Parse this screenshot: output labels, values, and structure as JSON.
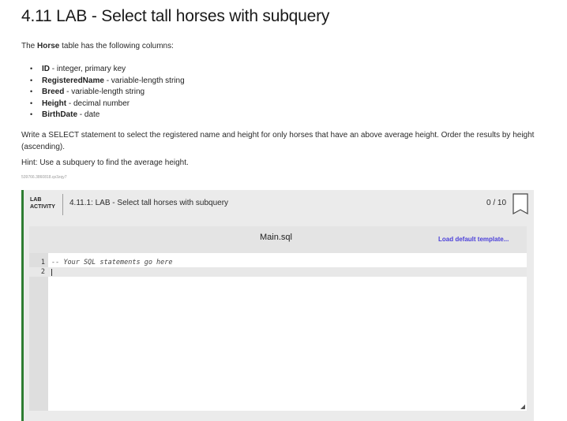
{
  "page": {
    "title": "4.11 LAB - Select tall horses with subquery",
    "intro_pre": "The ",
    "intro_table": "Horse",
    "intro_post": " table has the following columns:",
    "columns": [
      {
        "name": "ID",
        "desc": " - integer, primary key"
      },
      {
        "name": "RegisteredName",
        "desc": " - variable-length string"
      },
      {
        "name": "Breed",
        "desc": " - variable-length string"
      },
      {
        "name": "Height",
        "desc": " - decimal number"
      },
      {
        "name": "BirthDate",
        "desc": " - date"
      }
    ],
    "instructions": "Write a SELECT statement to select the registered name and height for only horses that have an above average height. Order the results by height (ascending).",
    "hint": "Hint: Use a subquery to find the average height.",
    "tracking_code": "539766.3860818.qx3zqy7"
  },
  "activity": {
    "label_line1": "LAB",
    "label_line2": "ACTIVITY",
    "title": "4.11.1: LAB - Select tall horses with subquery",
    "score": "0 / 10",
    "accent_color": "#2e7d32"
  },
  "editor": {
    "filename": "Main.sql",
    "load_default": "Load default template...",
    "lines": [
      {
        "num": "1",
        "text": "-- Your SQL statements go here"
      },
      {
        "num": "2",
        "text": ""
      }
    ]
  }
}
